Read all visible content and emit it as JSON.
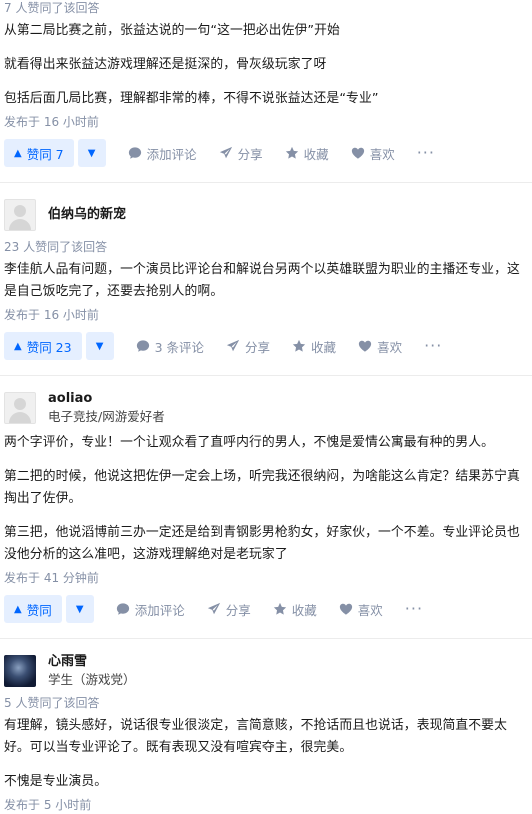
{
  "answers": [
    {
      "vote_count": "7 人赞同了该回答",
      "paragraphs": [
        "从第二局比赛之前，张益达说的一句“这一把必出佐伊”开始",
        "就看得出来张益达游戏理解还是挺深的，骨灰级玩家了呀",
        "包括后面几局比赛，理解都非常的棒，不得不说张益达还是“专业”"
      ],
      "time": "发布于 16 小时前",
      "actions": {
        "vote": "赞同 7",
        "comment": "添加评论",
        "share": "分享",
        "favorite": "收藏",
        "like": "喜欢",
        "more": "···"
      }
    },
    {
      "author": {
        "name": "伯纳乌的新宠",
        "bio": ""
      },
      "vote_count": "23 人赞同了该回答",
      "paragraphs": [
        "李佳航人品有问题，一个演员比评论台和解说台另两个以英雄联盟为职业的主播还专业，这是自己饭吃完了，还要去抢别人的啊。"
      ],
      "time": "发布于 16 小时前",
      "actions": {
        "vote": "赞同 23",
        "comment": "3 条评论",
        "share": "分享",
        "favorite": "收藏",
        "like": "喜欢",
        "more": "···"
      }
    },
    {
      "author": {
        "name": "aoliao",
        "bio": "电子竞技/网游爱好者"
      },
      "vote_count": "",
      "paragraphs": [
        "两个字评价，专业！一个让观众看了直呼内行的男人，不愧是爱情公寓最有种的男人。",
        "第二把的时候，他说这把佐伊一定会上场，听完我还很纳闷，为啥能这么肯定？结果苏宁真掏出了佐伊。",
        "第三把，他说滔博前三办一定还是给到青钢影男枪豹女，好家伙，一个不差。专业评论员也没他分析的这么准吧，这游戏理解绝对是老玩家了"
      ],
      "time": "发布于 41 分钟前",
      "actions": {
        "vote": "赞同",
        "comment": "添加评论",
        "share": "分享",
        "favorite": "收藏",
        "like": "喜欢",
        "more": "···"
      }
    },
    {
      "author": {
        "name": "心雨雪",
        "bio": "学生（游戏党）"
      },
      "vote_count": "5 人赞同了该回答",
      "paragraphs": [
        "有理解，镜头感好，说话很专业很淡定，言简意赅，不抢话而且也说话，表现简直不要太好。可以当专业评论了。既有表现又没有喧宾夺主，很完美。",
        "不愧是专业演员。"
      ],
      "time": "发布于 5 小时前"
    }
  ],
  "icons": {
    "comment": "comment-bubble-icon",
    "share": "paper-plane-icon",
    "favorite": "star-icon",
    "like": "heart-icon",
    "vote_up": "triangle-up-icon",
    "vote_down": "triangle-down-icon"
  },
  "colors": {
    "accent": "#0066ff",
    "accent_bg": "#e5efff",
    "meta": "#8590a6"
  }
}
